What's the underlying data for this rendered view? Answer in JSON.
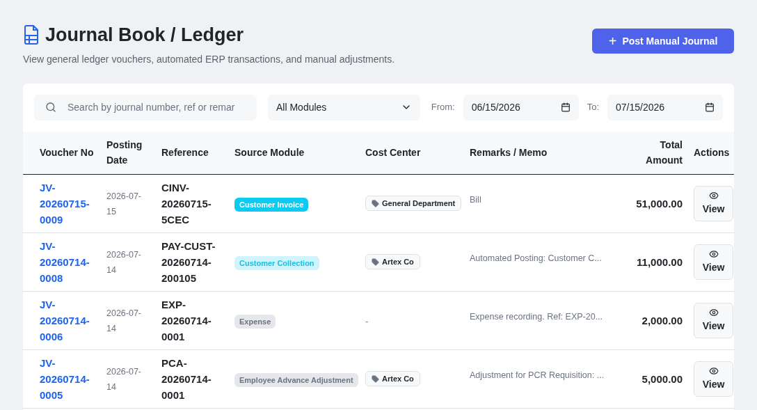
{
  "header": {
    "title": "Journal Book / Ledger",
    "subtitle": "View general ledger vouchers, automated ERP transactions, and manual adjustments.",
    "action": "Post Manual Journal",
    "action_icon": "+"
  },
  "filters": {
    "search": {
      "placeholder": "Search by journal number, ref or remar"
    },
    "module": {
      "value": "All Modules"
    },
    "from": {
      "label": "From:",
      "value": "06/15/2026"
    },
    "to": {
      "label": "To:",
      "value": "07/15/2026"
    }
  },
  "table": {
    "columns": [
      "Voucher No",
      "Posting Date",
      "Reference",
      "Source Module",
      "Cost Center",
      "Remarks / Memo",
      "Total Amount",
      "Actions"
    ],
    "rows": [
      {
        "voucher": "JV-20260715-0009",
        "date": "2026-07-15",
        "reference": "CINV-20260715-5CEC",
        "module": {
          "label": "Customer Invoice",
          "kind": "solid"
        },
        "cost_center": {
          "label": "General Department",
          "kind": "tag"
        },
        "remarks": "Bill",
        "amount": "51,000.00",
        "action": "View"
      },
      {
        "voucher": "JV-20260714-0008",
        "date": "2026-07-14",
        "reference": "PAY-CUST-20260714-200105",
        "module": {
          "label": "Customer Collection",
          "kind": "light"
        },
        "cost_center": {
          "label": "Artex Co",
          "kind": "tag"
        },
        "remarks": "Automated Posting: Customer C...",
        "amount": "11,000.00",
        "action": "View"
      },
      {
        "voucher": "JV-20260714-0006",
        "date": "2026-07-14",
        "reference": "EXP-20260714-0001",
        "module": {
          "label": "Expense",
          "kind": "muted"
        },
        "cost_center": {
          "label": "-",
          "kind": "none"
        },
        "remarks": "Expense recording. Ref: EXP-20...",
        "amount": "2,000.00",
        "action": "View"
      },
      {
        "voucher": "JV-20260714-0005",
        "date": "2026-07-14",
        "reference": "PCA-20260714-0001",
        "module": {
          "label": "Employee Advance Adjustment",
          "kind": "muted"
        },
        "cost_center": {
          "label": "Artex Co",
          "kind": "tag"
        },
        "remarks": "Adjustment for PCR Requisition: ...",
        "amount": "5,000.00",
        "action": "View"
      }
    ]
  }
}
